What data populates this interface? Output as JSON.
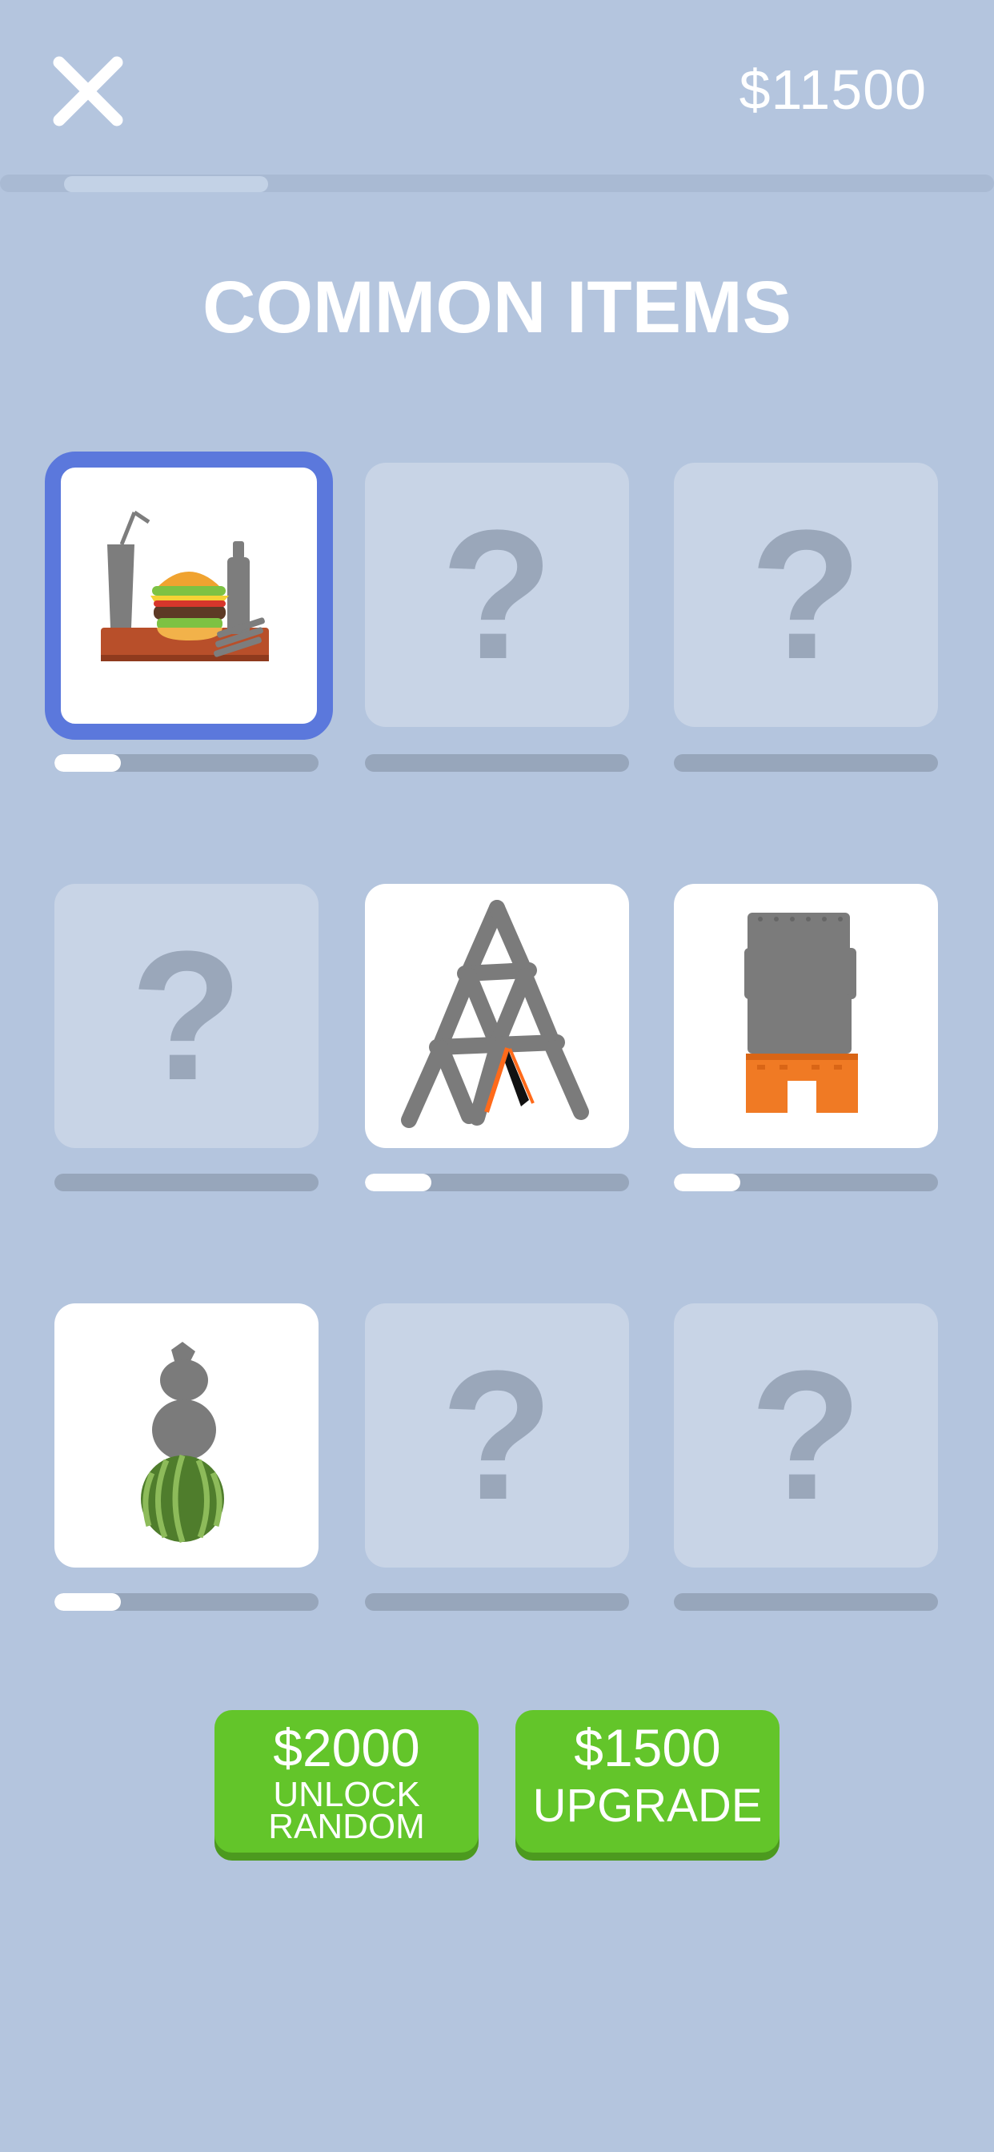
{
  "header": {
    "close_icon": "close-x-icon",
    "money": "$11500"
  },
  "page_title": "COMMON ITEMS",
  "items": [
    {
      "state": "selected",
      "icon": "burger-meal-icon",
      "progress": 0.25
    },
    {
      "state": "locked",
      "mark": "?",
      "progress": 0
    },
    {
      "state": "locked",
      "mark": "?",
      "progress": 0
    },
    {
      "state": "locked",
      "mark": "?",
      "progress": 0
    },
    {
      "state": "unlocked",
      "icon": "card-house-icon",
      "progress": 0.25
    },
    {
      "state": "unlocked",
      "icon": "brick-stack-icon",
      "progress": 0.25
    },
    {
      "state": "unlocked",
      "icon": "watermelon-stack-icon",
      "progress": 0.25
    },
    {
      "state": "locked",
      "mark": "?",
      "progress": 0
    },
    {
      "state": "locked",
      "mark": "?",
      "progress": 0
    }
  ],
  "buttons": {
    "unlock": {
      "price": "$2000",
      "line1": "UNLOCK",
      "line2": "RANDOM"
    },
    "upgrade": {
      "price": "$1500",
      "label": "UPGRADE"
    }
  },
  "colors": {
    "background": "#b4c5de",
    "selected_border": "#5b78dc",
    "button_green": "#63c52a"
  }
}
